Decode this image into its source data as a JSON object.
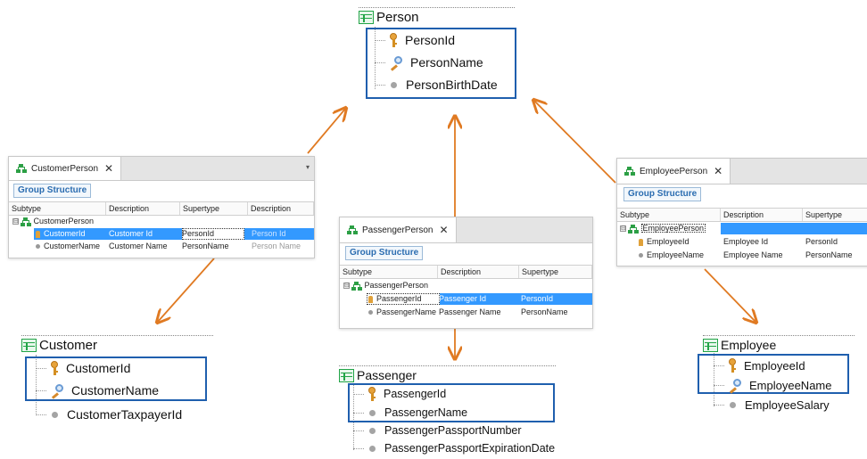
{
  "colors": {
    "arrow": "#e07a22",
    "highlight": "#1f5fae",
    "table_icon": "#22a447",
    "selection": "#3399ff"
  },
  "transactions": {
    "person": {
      "title": "Person",
      "icon": "table-icon",
      "attributes": [
        {
          "name": "PersonId",
          "icon": "key-icon"
        },
        {
          "name": "PersonName",
          "icon": "description-icon"
        },
        {
          "name": "PersonBirthDate",
          "icon": "dot-icon"
        }
      ]
    },
    "customer": {
      "title": "Customer",
      "icon": "table-icon",
      "attributes": [
        {
          "name": "CustomerId",
          "icon": "key-icon"
        },
        {
          "name": "CustomerName",
          "icon": "description-icon"
        },
        {
          "name": "CustomerTaxpayerId",
          "icon": "dot-icon"
        }
      ]
    },
    "passenger": {
      "title": "Passenger",
      "icon": "table-icon",
      "attributes": [
        {
          "name": "PassengerId",
          "icon": "key-icon"
        },
        {
          "name": "PassengerName",
          "icon": "dot-icon"
        },
        {
          "name": "PassengerPassportNumber",
          "icon": "dot-icon"
        },
        {
          "name": "PassengerPassportExpirationDate",
          "icon": "dot-icon"
        }
      ]
    },
    "employee": {
      "title": "Employee",
      "icon": "table-icon",
      "attributes": [
        {
          "name": "EmployeeId",
          "icon": "key-icon"
        },
        {
          "name": "EmployeeName",
          "icon": "description-icon"
        },
        {
          "name": "EmployeeSalary",
          "icon": "dot-icon"
        }
      ]
    }
  },
  "subtype_panels": {
    "customer_person": {
      "tab_label": "CustomerPerson",
      "close": "✕",
      "menu": "▾",
      "group_button": "Group Structure",
      "columns": [
        "Subtype",
        "Description",
        "Supertype",
        "Description"
      ],
      "root": "CustomerPerson",
      "expand": "⊟",
      "rows": [
        {
          "subtype": "CustomerId",
          "description": "Customer Id",
          "supertype": "PersonId",
          "super_description": "Person Id",
          "icon": "key-icon",
          "selected": true
        },
        {
          "subtype": "CustomerName",
          "description": "Customer Name",
          "supertype": "PersonName",
          "super_description": "Person Name",
          "icon": "dot-icon",
          "selected": false
        }
      ]
    },
    "passenger_person": {
      "tab_label": "PassengerPerson",
      "close": "✕",
      "group_button": "Group Structure",
      "columns": [
        "Subtype",
        "Description",
        "Supertype"
      ],
      "root": "PassengerPerson",
      "expand": "⊟",
      "rows": [
        {
          "subtype": "PassengerId",
          "description": "Passenger Id",
          "supertype": "PersonId",
          "icon": "key-icon",
          "selected": true
        },
        {
          "subtype": "PassengerName",
          "description": "Passenger Name",
          "supertype": "PersonName",
          "icon": "dot-icon",
          "selected": false
        }
      ]
    },
    "employee_person": {
      "tab_label": "EmployeePerson",
      "close": "✕",
      "group_button": "Group Structure",
      "columns": [
        "Subtype",
        "Description",
        "Supertype"
      ],
      "root": "EmployeePerson",
      "expand": "⊟",
      "rows": [
        {
          "subtype": "EmployeeId",
          "description": "Employee Id",
          "supertype": "PersonId",
          "icon": "key-icon",
          "selected": false
        },
        {
          "subtype": "EmployeeName",
          "description": "Employee Name",
          "supertype": "PersonName",
          "icon": "dot-icon",
          "selected": false
        }
      ]
    }
  }
}
